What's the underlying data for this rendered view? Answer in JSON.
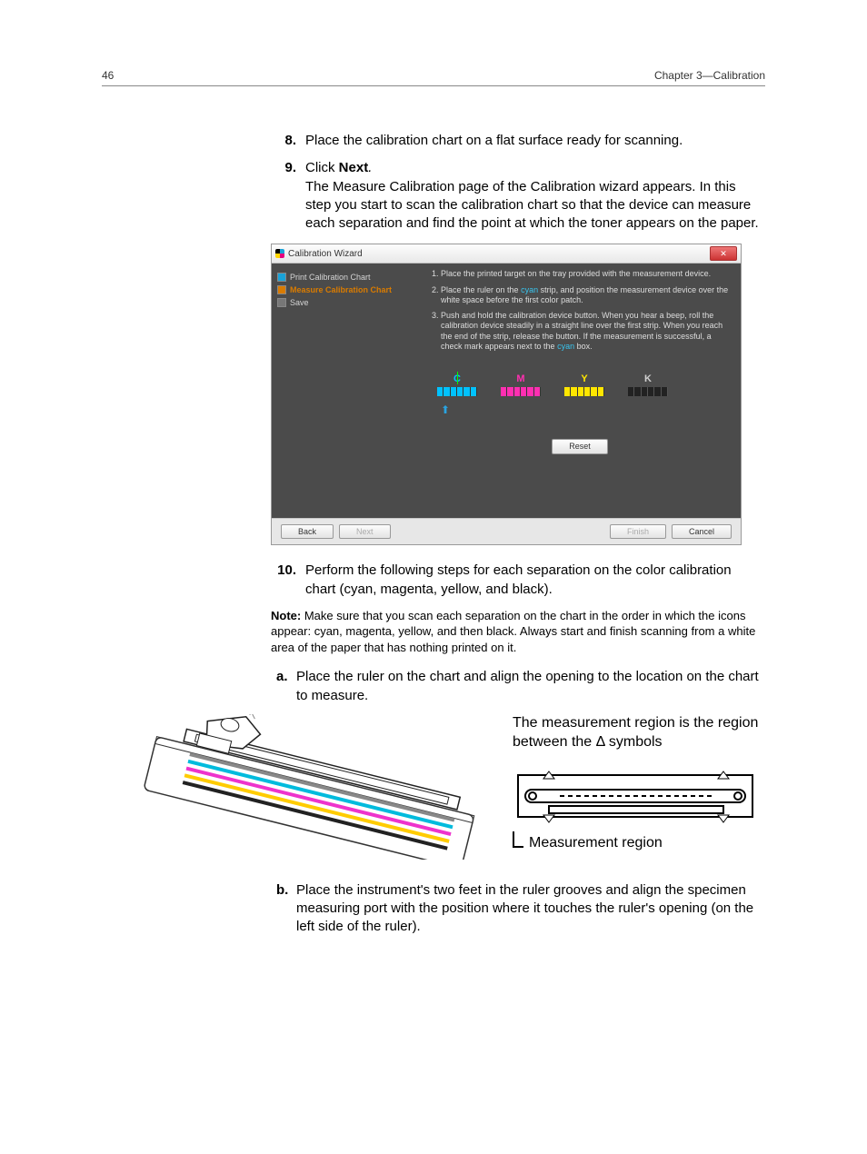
{
  "header": {
    "page_number": "46",
    "chapter": "Chapter 3—Calibration"
  },
  "steps": {
    "s8": {
      "num": "8.",
      "text": "Place the calibration chart on a flat surface ready for scanning."
    },
    "s9": {
      "num": "9.",
      "lead_a": "Click ",
      "lead_bold": "Next",
      "lead_b": ".",
      "body": "The Measure Calibration page of the Calibration wizard appears. In this step you start to scan the calibration chart so that the device can measure each separation and find the point at which the toner appears on the paper."
    },
    "s10": {
      "num": "10.",
      "text": "Perform the following steps for each separation on the color calibration chart (cyan, magenta, yellow, and black)."
    }
  },
  "wizard": {
    "title": "Calibration Wizard",
    "sidebar": {
      "items": [
        {
          "label": "Print Calibration Chart"
        },
        {
          "label": "Measure Calibration Chart"
        },
        {
          "label": "Save"
        }
      ]
    },
    "instructions": {
      "i1": "Place the printed target on the tray provided with the measurement device.",
      "i2a": "Place the ruler on the ",
      "i2cyan": "cyan",
      "i2b": " strip, and position the measurement device over the white space before the first color patch.",
      "i3a": "Push and hold the calibration device button. When you hear a beep, roll the calibration device steadily in a straight line over the first strip. When you reach the end of the strip, release the button. If the measurement is successful, a check mark appears next to the ",
      "i3cyan": "cyan",
      "i3b": " box."
    },
    "strips": {
      "c": "C",
      "m": "M",
      "y": "Y",
      "k": "K"
    },
    "buttons": {
      "reset": "Reset",
      "back": "Back",
      "next": "Next",
      "finish": "Finish",
      "cancel": "Cancel"
    }
  },
  "note": {
    "label": "Note:",
    "text": " Make sure that you scan each separation on the chart in the order in which the icons appear: cyan, magenta, yellow, and then black. Always start and finish scanning from a white area of the paper that has nothing printed on it."
  },
  "substeps": {
    "a": {
      "num": "a.",
      "text": "Place the ruler on the chart and align the opening to the location on the chart to measure."
    },
    "b": {
      "num": "b.",
      "text": "Place the instrument's two feet in the ruler grooves and align the specimen measuring port with the position where it touches the ruler's opening (on the left side of the ruler)."
    }
  },
  "illus": {
    "caption": "The measurement region is the region between the Δ symbols",
    "mr_label": "Measurement region"
  }
}
